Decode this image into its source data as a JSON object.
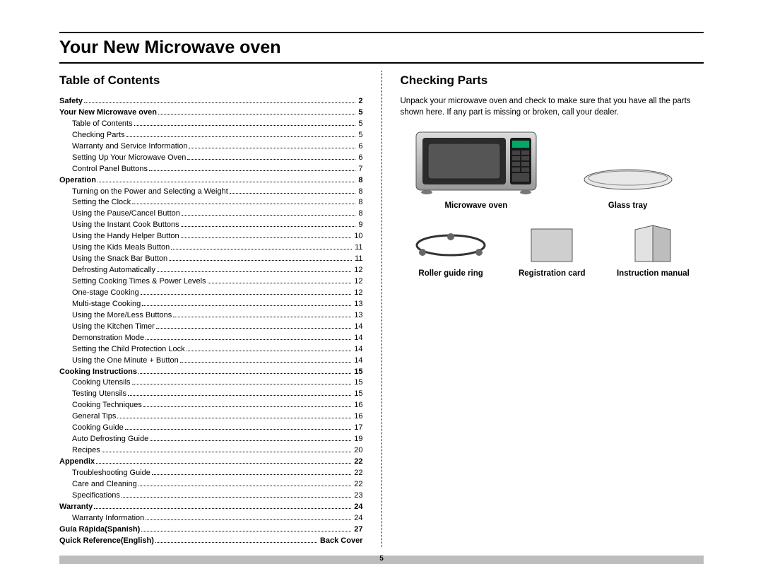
{
  "title": "Your New Microwave oven",
  "page_number": "5",
  "left": {
    "heading": "Table of Contents",
    "toc": [
      {
        "label": "Safety",
        "page": "2",
        "bold": true,
        "indent": 0
      },
      {
        "label": "Your New Microwave oven",
        "page": "5",
        "bold": true,
        "indent": 0
      },
      {
        "label": "Table of Contents",
        "page": "5",
        "bold": false,
        "indent": 1
      },
      {
        "label": "Checking Parts",
        "page": "5",
        "bold": false,
        "indent": 1
      },
      {
        "label": "Warranty and Service Information",
        "page": "6",
        "bold": false,
        "indent": 1
      },
      {
        "label": "Setting Up Your Microwave Oven",
        "page": "6",
        "bold": false,
        "indent": 1
      },
      {
        "label": "Control Panel Buttons",
        "page": "7",
        "bold": false,
        "indent": 1
      },
      {
        "label": "Operation",
        "page": "8",
        "bold": true,
        "indent": 0
      },
      {
        "label": "Turning on the Power and Selecting a Weight",
        "page": "8",
        "bold": false,
        "indent": 1
      },
      {
        "label": "Setting the Clock",
        "page": "8",
        "bold": false,
        "indent": 1
      },
      {
        "label": "Using the Pause/Cancel Button",
        "page": "8",
        "bold": false,
        "indent": 1
      },
      {
        "label": "Using the Instant Cook Buttons",
        "page": "9",
        "bold": false,
        "indent": 1
      },
      {
        "label": "Using the Handy Helper Button",
        "page": "10",
        "bold": false,
        "indent": 1
      },
      {
        "label": "Using the Kids Meals Button",
        "page": "11",
        "bold": false,
        "indent": 1
      },
      {
        "label": "Using the Snack Bar Button",
        "page": "11",
        "bold": false,
        "indent": 1
      },
      {
        "label": "Defrosting Automatically",
        "page": "12",
        "bold": false,
        "indent": 1
      },
      {
        "label": "Setting Cooking Times & Power Levels",
        "page": "12",
        "bold": false,
        "indent": 1
      },
      {
        "label": "One-stage Cooking",
        "page": "12",
        "bold": false,
        "indent": 1
      },
      {
        "label": "Multi-stage Cooking",
        "page": "13",
        "bold": false,
        "indent": 1
      },
      {
        "label": "Using the More/Less Buttons",
        "page": "13",
        "bold": false,
        "indent": 1
      },
      {
        "label": "Using the Kitchen Timer",
        "page": "14",
        "bold": false,
        "indent": 1
      },
      {
        "label": "Demonstration Mode",
        "page": "14",
        "bold": false,
        "indent": 1
      },
      {
        "label": "Setting the Child Protection Lock",
        "page": "14",
        "bold": false,
        "indent": 1
      },
      {
        "label": "Using the One Minute + Button",
        "page": "14",
        "bold": false,
        "indent": 1
      },
      {
        "label": "Cooking Instructions",
        "page": "15",
        "bold": true,
        "indent": 0
      },
      {
        "label": "Cooking Utensils",
        "page": "15",
        "bold": false,
        "indent": 1
      },
      {
        "label": "Testing Utensils",
        "page": "15",
        "bold": false,
        "indent": 1
      },
      {
        "label": "Cooking Techniques",
        "page": "16",
        "bold": false,
        "indent": 1
      },
      {
        "label": "General Tips",
        "page": "16",
        "bold": false,
        "indent": 1
      },
      {
        "label": "Cooking Guide",
        "page": "17",
        "bold": false,
        "indent": 1
      },
      {
        "label": "Auto Defrosting Guide",
        "page": "19",
        "bold": false,
        "indent": 1
      },
      {
        "label": "Recipes",
        "page": "20",
        "bold": false,
        "indent": 1
      },
      {
        "label": "Appendix",
        "page": "22",
        "bold": true,
        "indent": 0
      },
      {
        "label": "Troubleshooting Guide",
        "page": "22",
        "bold": false,
        "indent": 1
      },
      {
        "label": "Care and Cleaning",
        "page": "22",
        "bold": false,
        "indent": 1
      },
      {
        "label": "Specifications",
        "page": "23",
        "bold": false,
        "indent": 1
      },
      {
        "label": "Warranty",
        "page": "24",
        "bold": true,
        "indent": 0
      },
      {
        "label": "Warranty Information",
        "page": "24",
        "bold": false,
        "indent": 1
      },
      {
        "label": "Guía Rápida(Spanish)",
        "page": "27",
        "bold": true,
        "indent": 0
      },
      {
        "label": "Quick Reference(English)",
        "page": "Back Cover",
        "bold": true,
        "indent": 0
      }
    ]
  },
  "right": {
    "heading": "Checking Parts",
    "intro": "Unpack your microwave oven and check to make sure that you have all the parts shown here. If any part is missing or broken, call your dealer.",
    "parts": {
      "microwave": "Microwave oven",
      "glass_tray": "Glass tray",
      "roller_ring": "Roller guide ring",
      "reg_card": "Registration card",
      "manual": "Instruction manual"
    }
  }
}
